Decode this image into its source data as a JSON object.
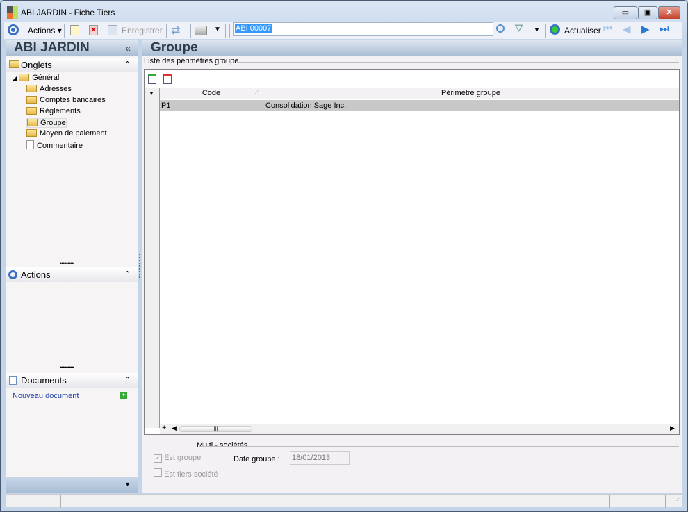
{
  "window": {
    "title": "ABI JARDIN -  Fiche Tiers",
    "minimize": "▭",
    "maximize": "▣",
    "close": "✕"
  },
  "toolbar": {
    "actions": "Actions",
    "save": "Enregistrer",
    "search_value": "ABI 00007",
    "refresh": "Actualiser"
  },
  "left": {
    "title": "ABI JARDIN",
    "collapse": "«",
    "onglets": "Onglets",
    "actions": "Actions",
    "documents": "Documents",
    "tree": {
      "root": "Général",
      "items": [
        "Adresses",
        "Comptes bancaires",
        "Règlements",
        "Groupe",
        "Moyen de paiement",
        "Commentaire"
      ]
    },
    "new_document": "Nouveau document"
  },
  "main": {
    "title": "Groupe",
    "list_label": "Liste des périmètres groupe",
    "columns": [
      "Code",
      "Périmètre groupe"
    ],
    "rows": [
      {
        "code": "P1",
        "perimetre": "Consolidation Sage Inc."
      }
    ],
    "multi_label": "Multi - sociétés",
    "est_groupe": "Est groupe",
    "est_groupe_checked": true,
    "est_tiers": "Est tiers société",
    "est_tiers_checked": false,
    "date_label": "Date groupe :",
    "date_value": "18/01/2013"
  }
}
